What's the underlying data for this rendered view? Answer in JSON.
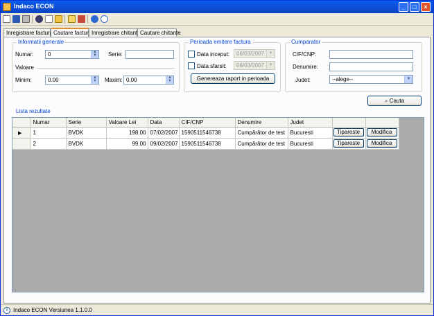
{
  "window": {
    "title": "Indaco ECON"
  },
  "tabs": [
    "Inregistrare factura",
    "Cautare facturi",
    "Inregistrare chitanta",
    "Cautare chitante"
  ],
  "general": {
    "title": "Informatii generale",
    "numar_label": "Numar:",
    "numar_value": "0",
    "serie_label": "Serie:",
    "serie_value": "",
    "valoare_label": "Valoare",
    "minim_label": "Minim:",
    "minim_value": "0.00",
    "maxim_label": "Maxim:",
    "maxim_value": "0.00"
  },
  "perioada": {
    "title": "Perioada emitere factura",
    "inceput_label": "Data inceput:",
    "inceput_value": "06/03/2007",
    "sfarsit_label": "Data sfarsit:",
    "sfarsit_value": "06/03/2007",
    "report_button": "Genereaza raport in perioada"
  },
  "cumparator": {
    "title": "Cumparator",
    "cif_label": "CIF/CNP:",
    "cif_value": "",
    "denumire_label": "Denumire:",
    "denumire_value": "",
    "judet_label": "Judet:",
    "judet_value": "--alege--"
  },
  "search_button": "Cauta",
  "results": {
    "title": "Lista rezultate",
    "columns": [
      "Numar",
      "Serie",
      "Valoare Lei",
      "Data",
      "CIF/CNP",
      "Denumire",
      "Judet"
    ],
    "rows": [
      {
        "numar": "1",
        "serie": "BVDK",
        "valoare": "198.00",
        "data": "07/02/2007",
        "cif": "1590511546738",
        "denumire": "Cumpărător de test",
        "judet": "Bucuresti",
        "btn1": "Tipareste",
        "btn2": "Modifica"
      },
      {
        "numar": "2",
        "serie": "BVDK",
        "valoare": "99.00",
        "data": "09/02/2007",
        "cif": "1590511546738",
        "denumire": "Cumpărător de test",
        "judet": "Bucuresti",
        "btn1": "Tipareste",
        "btn2": "Modifica"
      }
    ]
  },
  "status": {
    "text": "Indaco ECON Versiunea 1.1.0.0"
  }
}
